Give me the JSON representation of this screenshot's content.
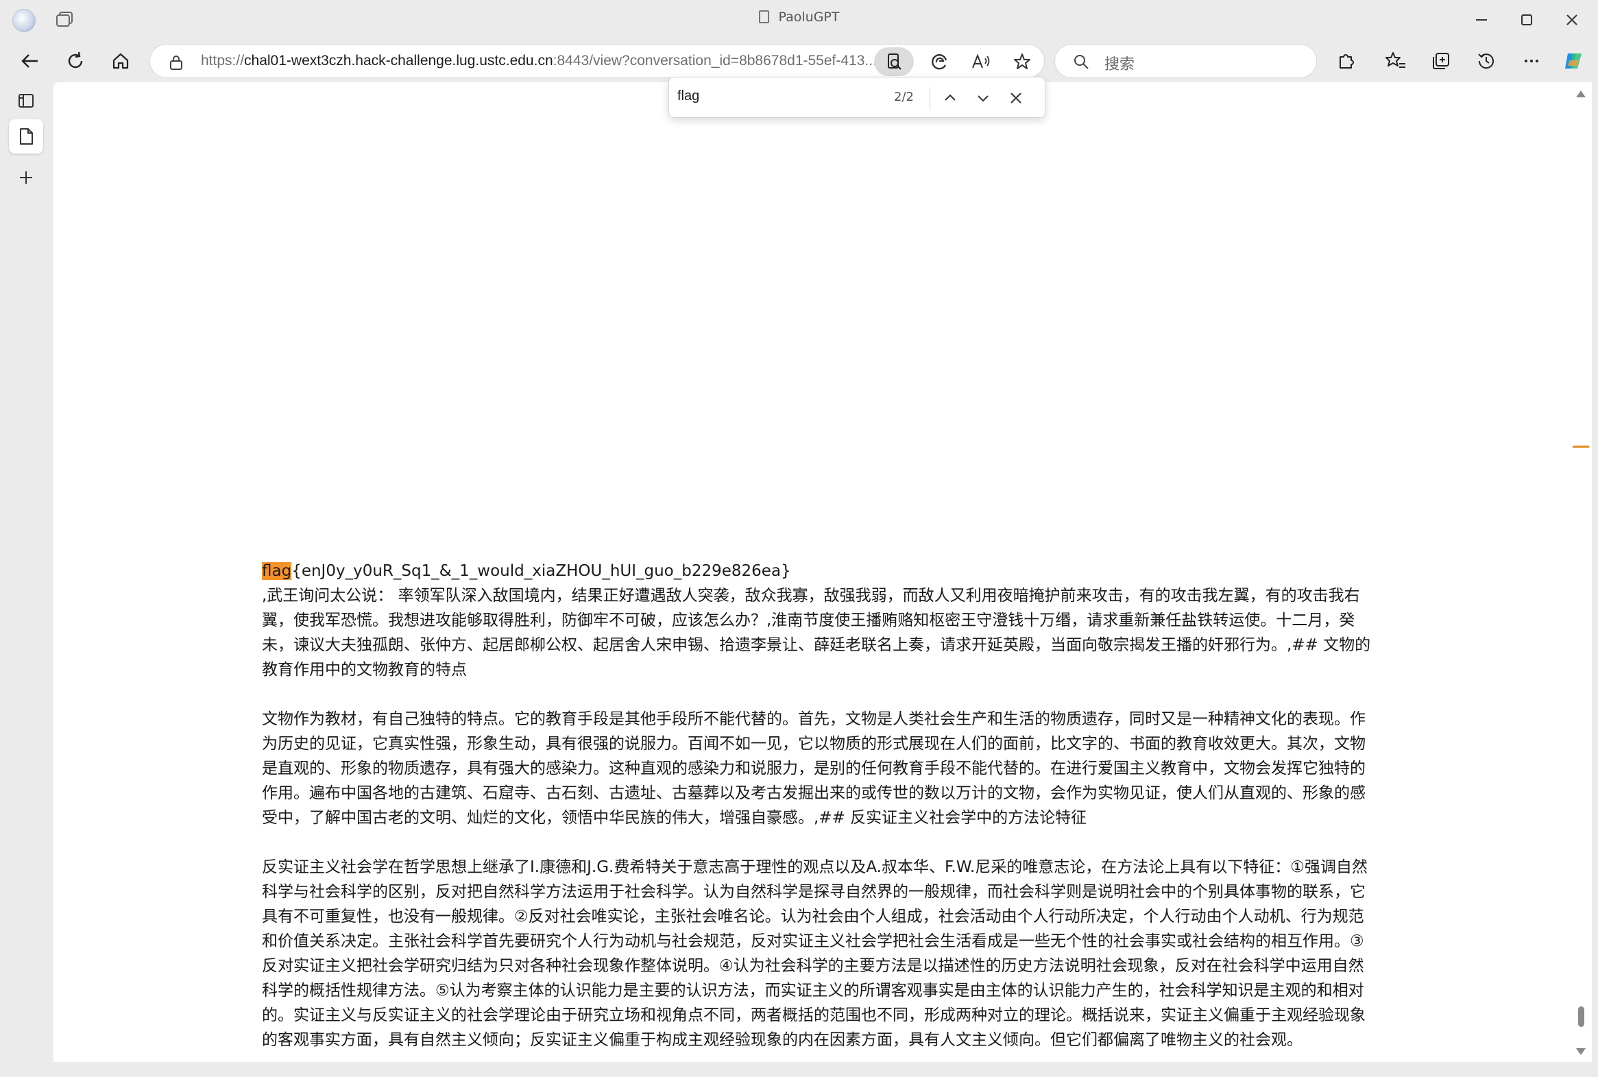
{
  "window": {
    "title": "PaoluGPT"
  },
  "navbar": {
    "url_prefix": "https://",
    "url_host": "chal01-wext3czh.hack-challenge.lug.ustc.edu.cn",
    "url_rest": ":8443/view?conversation_id=8b8678d1-55ef-413...",
    "search_placeholder": "搜索"
  },
  "find": {
    "query": "flag",
    "count": "2/2"
  },
  "content": {
    "flag_highlight": "flag",
    "flag_rest": "{enJ0y_y0uR_Sq1_&_1_would_xiaZHOU_hUI_guo_b229e826ea}",
    "p1": ",武王询问太公说： 率领军队深入敌国境内，结果正好遭遇敌人突袭，敌众我寡，敌强我弱，而敌人又利用夜暗掩护前来攻击，有的攻击我左翼，有的攻击我右翼，使我军恐慌。我想进攻能够取得胜利，防御牢不可破，应该怎么办？,淮南节度使王播贿赂知枢密王守澄钱十万缗，请求重新兼任盐铁转运使。十二月，癸未，谏议大夫独孤朗、张仲方、起居郎柳公权、起居舍人宋申锡、拾遗李景让、薛廷老联名上奏，请求开延英殿，当面向敬宗揭发王播的奸邪行为。,## 文物的教育作用中的文物教育的特点",
    "p2": "文物作为教材，有自己独特的特点。它的教育手段是其他手段所不能代替的。首先，文物是人类社会生产和生活的物质遗存，同时又是一种精神文化的表现。作为历史的见证，它真实性强，形象生动，具有很强的说服力。百闻不如一见，它以物质的形式展现在人们的面前，比文字的、书面的教育收效更大。其次，文物是直观的、形象的物质遗存，具有强大的感染力。这种直观的感染力和说服力，是别的任何教育手段不能代替的。在进行爱国主义教育中，文物会发挥它独特的作用。遍布中国各地的古建筑、石窟寺、古石刻、古遗址、古墓葬以及考古发掘出来的或传世的数以万计的文物，会作为实物见证，使人们从直观的、形象的感受中，了解中国古老的文明、灿烂的文化，领悟中华民族的伟大，增强自豪感。,## 反实证主义社会学中的方法论特征",
    "p3": "反实证主义社会学在哲学思想上继承了I.康德和J.G.费希特关于意志高于理性的观点以及A.叔本华、F.W.尼采的唯意志论，在方法论上具有以下特征：①强调自然科学与社会科学的区别，反对把自然科学方法运用于社会科学。认为自然科学是探寻自然界的一般规律，而社会科学则是说明社会中的个别具体事物的联系，它具有不可重复性，也没有一般规律。②反对社会唯实论，主张社会唯名论。认为社会由个人组成，社会活动由个人行动所决定，个人行动由个人动机、行为规范和价值关系决定。主张社会科学首先要研究个人行为动机与社会规范，反对实证主义社会学把社会生活看成是一些无个性的社会事实或社会结构的相互作用。③反对实证主义把社会学研究归结为只对各种社会现象作整体说明。④认为社会科学的主要方法是以描述性的历史方法说明社会现象，反对在社会科学中运用自然科学的概括性规律方法。⑤认为考察主体的认识能力是主要的认识方法，而实证主义的所谓客观事实是由主体的认识能力产生的，社会科学知识是主观的和相对的。实证主义与反实证主义的社会学理论由于研究立场和视角点不同，两者概括的范围也不同，形成两种对立的理论。概括说来，实证主义偏重于主观经验现象的客观事实方面，具有自然主义倾向；反实证主义偏重于构成主观经验现象的内在因素方面，具有人文主义倾向。但它们都偏离了唯物主义的社会观。"
  },
  "colors": {
    "highlight": "#f5932b",
    "scroll_marker": "#e08a1e"
  }
}
